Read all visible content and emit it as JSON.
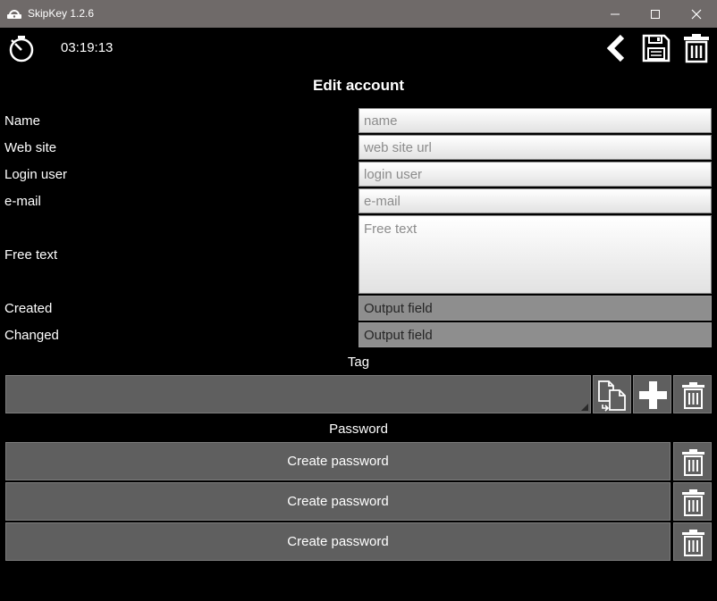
{
  "window": {
    "title": "SkipKey 1.2.6",
    "controls": [
      "minimize-icon",
      "maximize-icon",
      "close-icon"
    ]
  },
  "toolbar": {
    "timer": "03:19:13",
    "icons": [
      "stopwatch-icon",
      "back-icon",
      "save-icon",
      "trash-icon"
    ]
  },
  "form": {
    "heading": "Edit account",
    "fields": {
      "name": {
        "label": "Name",
        "placeholder": "name",
        "value": ""
      },
      "website": {
        "label": "Web site",
        "placeholder": "web site url",
        "value": ""
      },
      "login": {
        "label": "Login user",
        "placeholder": "login user",
        "value": ""
      },
      "email": {
        "label": "e-mail",
        "placeholder": "e-mail",
        "value": ""
      },
      "freetext": {
        "label": "Free text",
        "placeholder": "Free text",
        "value": ""
      },
      "created": {
        "label": "Created",
        "value": "Output field"
      },
      "changed": {
        "label": "Changed",
        "value": "Output field"
      }
    }
  },
  "tag": {
    "label": "Tag",
    "value": "",
    "icons": [
      "copy-icon",
      "add-icon",
      "trash-icon"
    ]
  },
  "password": {
    "label": "Password",
    "buttons": [
      {
        "label": "Create password"
      },
      {
        "label": "Create password"
      },
      {
        "label": "Create password"
      }
    ]
  },
  "colors": {
    "background": "#000000",
    "titlebar": "#6f6a69",
    "button": "#5f5f5f",
    "output_field": "#8e8e8e"
  }
}
